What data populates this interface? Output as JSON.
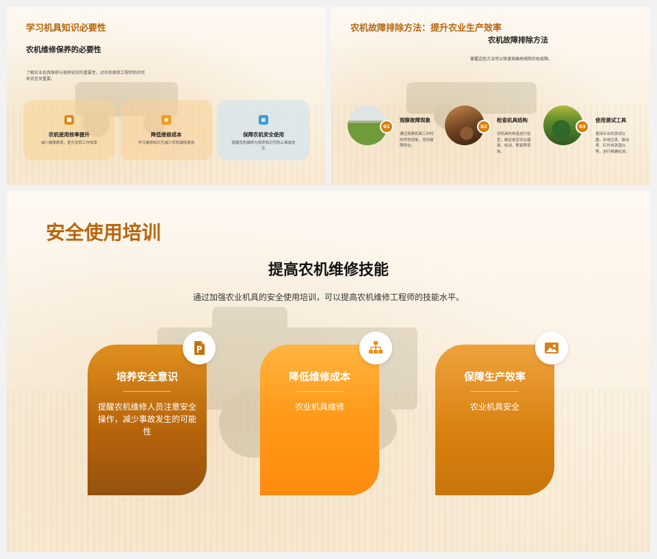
{
  "slide1": {
    "title": "学习机具知识必要性",
    "subtitle": "农机维修保养的必要性",
    "description": "了解农业机具维修与保养知识的重要性，对农机维修工程师和农民来说至关重要。",
    "cards": [
      {
        "icon": "briefcase-icon",
        "title": "农机使用效率提升",
        "desc": "减少故障频率，提升农机工作效率"
      },
      {
        "icon": "target-icon",
        "title": "降低维修成本",
        "desc": "学习维修知识可减少农机维修费用"
      },
      {
        "icon": "chat-icon",
        "title": "保障农机安全使用",
        "desc": "掌握农机维修与保养知识可防止事故发生"
      }
    ]
  },
  "slide2": {
    "title": "农机故障排除方法：提升农业生产效率",
    "subtitle": "农机故障排除方法",
    "description": "掌握这些方法可以快速准确地排除农机故障。",
    "steps": [
      {
        "num": "01",
        "title": "观察故障现象",
        "desc": "通过观察机具工作时的异常现象，找到故障所在。"
      },
      {
        "num": "02",
        "title": "检查机具结构",
        "desc": "对机具的构造进行检查，确定是否存在磨损、松动、断裂等现象。"
      },
      {
        "num": "03",
        "title": "使用测试工具",
        "desc": "使用专业的测试仪器，如电压表、振动表、红外线测温仪等，进行精确检测。"
      }
    ]
  },
  "slide3": {
    "title": "安全使用培训",
    "subtitle": "提高农机维修技能",
    "description": "通过加强农业机具的安全使用培训，可以提高农机维修工程师的技能水平。",
    "cards": [
      {
        "icon": "presentation-file-icon",
        "title": "培养安全意识",
        "desc": "提醒农机维修人员注意安全操作，减少事故发生的可能性"
      },
      {
        "icon": "org-chart-icon",
        "title": "降低维修成本",
        "desc": "农业机具维修"
      },
      {
        "icon": "image-icon",
        "title": "保障生产效率",
        "desc": "农业机具安全"
      }
    ]
  },
  "colors": {
    "accent_brown": "#b8650b",
    "accent_orange": "#ff9818",
    "number_badge": "#d9800e",
    "icon_blue": "#3d9ad6"
  }
}
